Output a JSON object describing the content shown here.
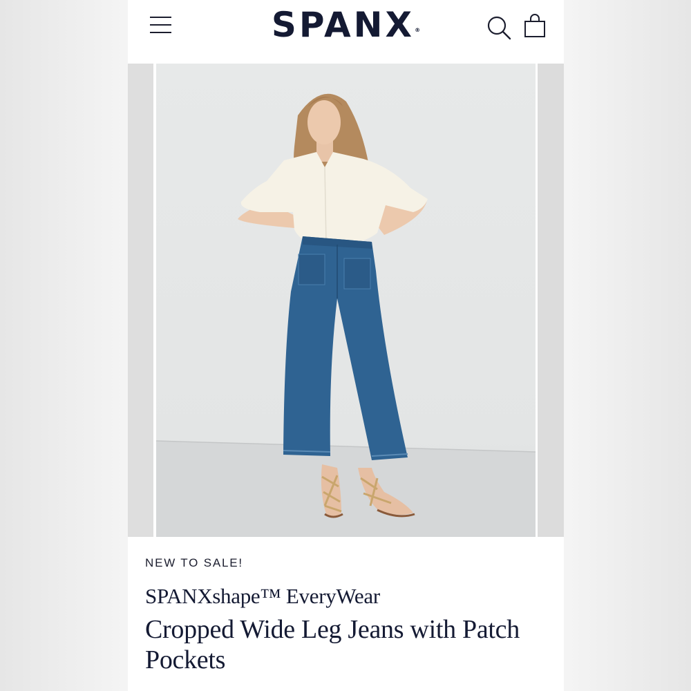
{
  "header": {
    "logo_text": "SPANX",
    "logo_mark": "®",
    "icons": {
      "menu": "hamburger-menu-icon",
      "search": "search-icon",
      "bag": "shopping-bag-icon"
    }
  },
  "product": {
    "badge": "NEW TO SALE!",
    "brand_line": "SPANXshape™ EveryWear",
    "name": "Cropped Wide Leg Jeans with Patch Pockets"
  },
  "colors": {
    "navy": "#141a33",
    "denim": "#2f6392",
    "background": "#e6e8e8"
  }
}
